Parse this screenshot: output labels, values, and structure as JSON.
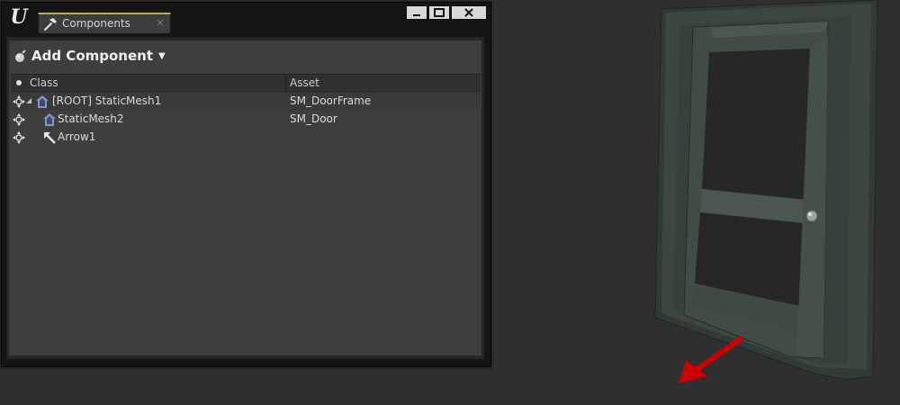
{
  "window": {
    "tab_label": "Components",
    "tab_close": "×"
  },
  "toolbar": {
    "add_component_label": "Add Component"
  },
  "columns": {
    "class": "Class",
    "asset": "Asset"
  },
  "rows": [
    {
      "name": "[ROOT] StaticMesh1",
      "asset": "SM_DoorFrame",
      "icon": "static-mesh-icon"
    },
    {
      "name": "StaticMesh2",
      "asset": "SM_Door",
      "icon": "static-mesh-icon"
    },
    {
      "name": "Arrow1",
      "asset": "",
      "icon": "arrow-component-icon"
    }
  ],
  "colors": {
    "viewport_bg": "#2f2f2f",
    "door": "#3b453f",
    "arrow": "#cc0000",
    "tab_accent": "#b8b050"
  }
}
